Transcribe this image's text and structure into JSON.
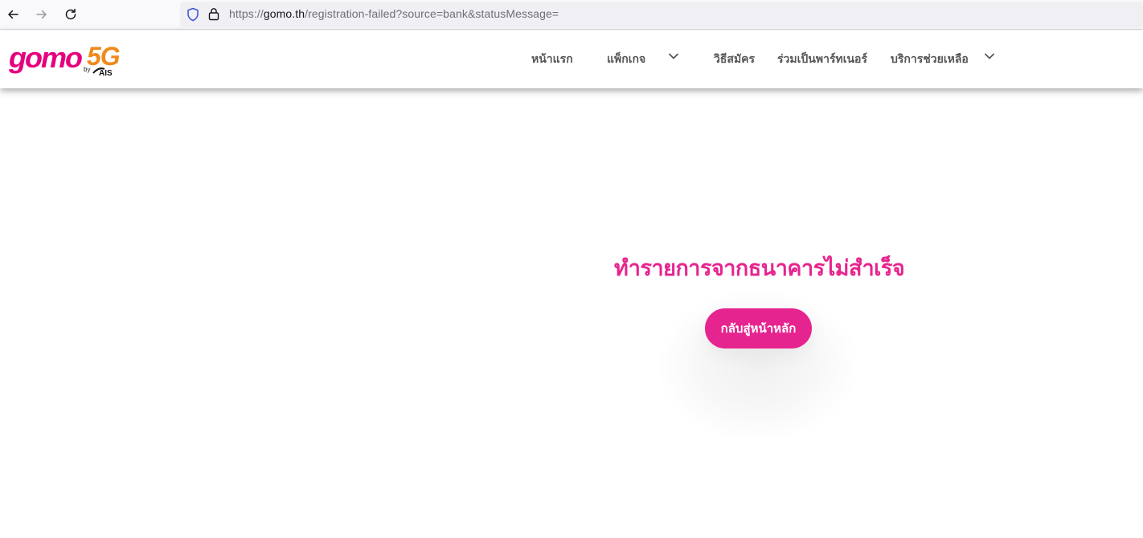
{
  "browser": {
    "url_scheme": "https://",
    "url_host": "gomo.th",
    "url_path": "/registration-failed?source=bank&statusMessage=",
    "icons": [
      "back-arrow-icon",
      "forward-arrow-icon",
      "reload-icon",
      "shield-icon",
      "lock-icon"
    ]
  },
  "header": {
    "logo": {
      "word": "gomo",
      "suffix": "5G",
      "by": "by",
      "brand": "AIS"
    },
    "menu": [
      {
        "label": "หน้าแรก"
      },
      {
        "label": "แพ็กเกจ",
        "has_dropdown": true
      },
      {
        "label": "วิธีสมัคร"
      },
      {
        "label": "ร่วมเป็นพาร์ทเนอร์"
      },
      {
        "label": "บริการช่วยเหลือ",
        "has_dropdown": true
      }
    ]
  },
  "main": {
    "title": "ทำรายการจากธนาคารไม่สำเร็จ",
    "home_button_label": "กลับสู่หน้าหลัก"
  },
  "colors": {
    "brand_pink": "#e6248f",
    "logo_orange": "#f08a1c",
    "menu_text": "#555555"
  }
}
